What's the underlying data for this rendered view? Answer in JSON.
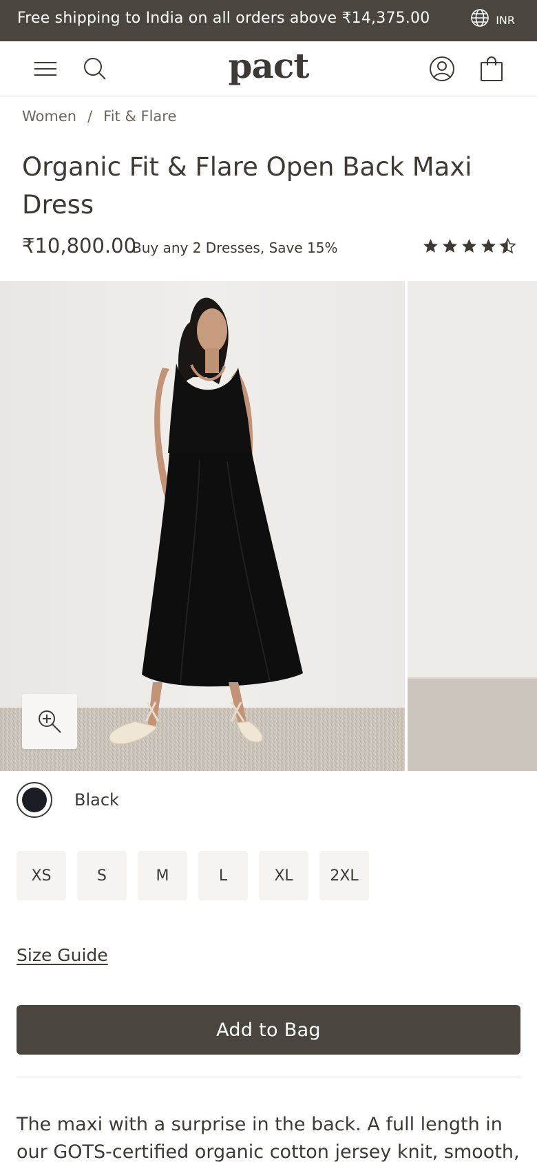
{
  "promo_bar": {
    "text": "Free shipping to India on all orders above ₹14,375.00",
    "currency": "INR"
  },
  "header": {
    "logo": "pact",
    "icons": [
      "menu-icon",
      "search-icon",
      "account-icon",
      "bag-icon"
    ]
  },
  "breadcrumb": {
    "items": [
      "Women",
      "Fit & Flare"
    ],
    "separator": "/"
  },
  "product": {
    "title": "Organic Fit & Flare Open Back Maxi Dress",
    "price": "₹10,800.00",
    "promo": "Buy any 2 Dresses, Save 15%",
    "rating": 4.5,
    "rating_max": 5
  },
  "colors": {
    "selected": "Black",
    "swatch_hex": "#1c1d24"
  },
  "sizes": [
    "XS",
    "S",
    "M",
    "L",
    "XL",
    "2XL"
  ],
  "size_guide_label": "Size Guide",
  "add_to_bag_label": "Add to Bag",
  "description": "The maxi with a surprise in the back. A full length in our GOTS-certified organic cotton jersey knit, smooth,",
  "theme": {
    "dark": "#4a463f",
    "text": "#3d3a35",
    "muted": "#6b6760",
    "chip_bg": "#f5f4f2"
  }
}
